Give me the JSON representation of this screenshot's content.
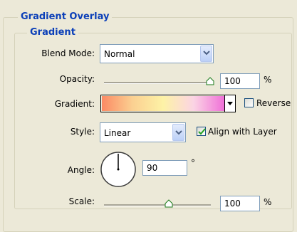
{
  "group_outer": {
    "title": "Gradient Overlay"
  },
  "group_inner": {
    "title": "Gradient"
  },
  "blend_mode": {
    "label": "Blend Mode:",
    "value": "Normal"
  },
  "opacity": {
    "label": "Opacity:",
    "value": "100",
    "unit": "%",
    "level": 1.0
  },
  "gradient": {
    "label": "Gradient:",
    "colors": [
      "#fb8a64",
      "#fbd091",
      "#fdf2a6",
      "#fbd4e4",
      "#f070d8"
    ],
    "reverse_label": "Reverse",
    "reverse_checked": false
  },
  "style": {
    "label": "Style:",
    "value": "Linear",
    "align_label": "Align with Layer",
    "align_checked": true
  },
  "angle": {
    "label": "Angle:",
    "value": "90",
    "unit": "°"
  },
  "scale": {
    "label": "Scale:",
    "value": "100",
    "unit": "%",
    "level": 0.5
  },
  "accent_color": "#0b3fb8"
}
